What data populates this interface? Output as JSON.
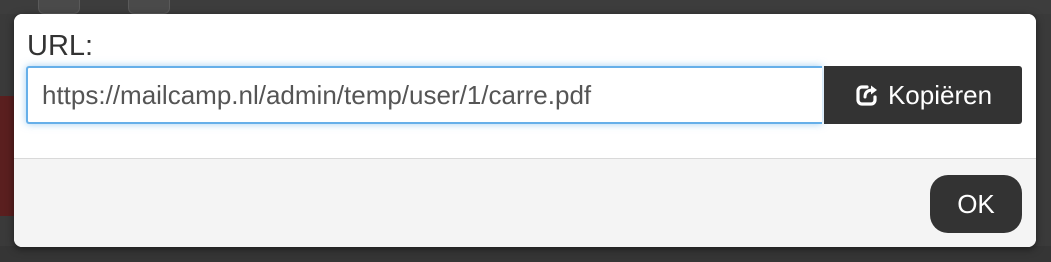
{
  "dialog": {
    "label": "URL:",
    "url_value": "https://mailcamp.nl/admin/temp/user/1/carre.pdf",
    "copy_button_label": "Kopiëren",
    "copy_icon": "share-icon",
    "ok_button_label": "OK"
  },
  "colors": {
    "button_bg": "#333333",
    "input_focus_border": "#66afe9",
    "footer_bg": "#f4f4f4"
  }
}
